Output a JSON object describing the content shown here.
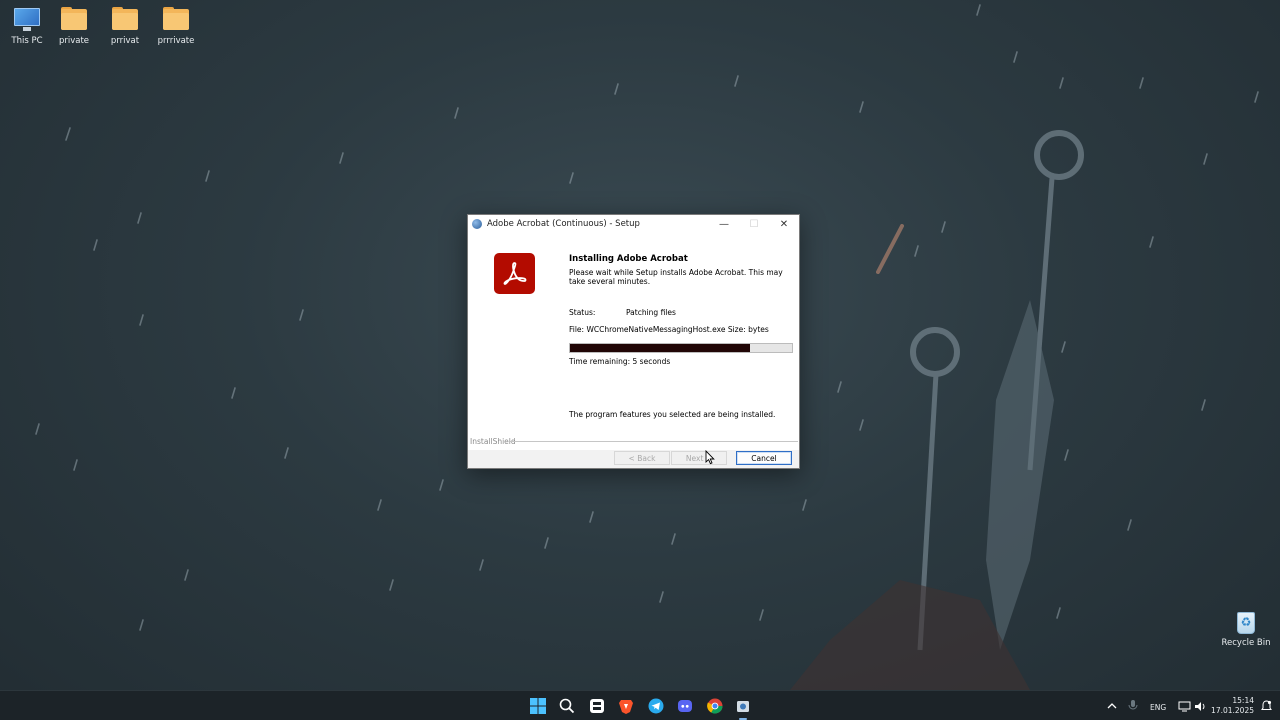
{
  "desktop": {
    "icons": [
      {
        "label": "This PC",
        "icon": "computer-icon"
      },
      {
        "label": "private",
        "icon": "folder-icon"
      },
      {
        "label": "prrivat",
        "icon": "folder-icon"
      },
      {
        "label": "prrrivate",
        "icon": "folder-icon"
      },
      {
        "label": "Recycle Bin",
        "icon": "recycle-bin-icon"
      }
    ]
  },
  "dialog": {
    "title": "Adobe Acrobat (Continuous) - Setup",
    "heading": "Installing Adobe Acrobat",
    "description": "Please wait while Setup installs Adobe Acrobat. This may take several minutes.",
    "status_label": "Status:",
    "status_value": "Patching files",
    "file_line": "File: WCChromeNativeMessagingHost.exe  Size:  bytes",
    "progress_percent": 81,
    "time_remaining": "Time remaining: 5 seconds",
    "features_text": "The program features you selected are being installed.",
    "footer_brand": "InstallShield",
    "buttons": {
      "back": "< Back",
      "next": "Next >",
      "cancel": "Cancel"
    },
    "title_buttons": {
      "minimize": "—",
      "maximize": "☐",
      "close": "✕"
    }
  },
  "taskbar": {
    "apps": [
      "start-icon",
      "search-icon",
      "task-view-icon",
      "brave-icon",
      "telegram-icon",
      "discord-icon",
      "chrome-icon",
      "setup-icon"
    ],
    "language": "ENG",
    "time": "15:14",
    "date": "17.01.2025"
  },
  "colors": {
    "acrobat_red": "#b30b00",
    "progress_fill": "#210606",
    "taskbar": "#1c2328"
  }
}
